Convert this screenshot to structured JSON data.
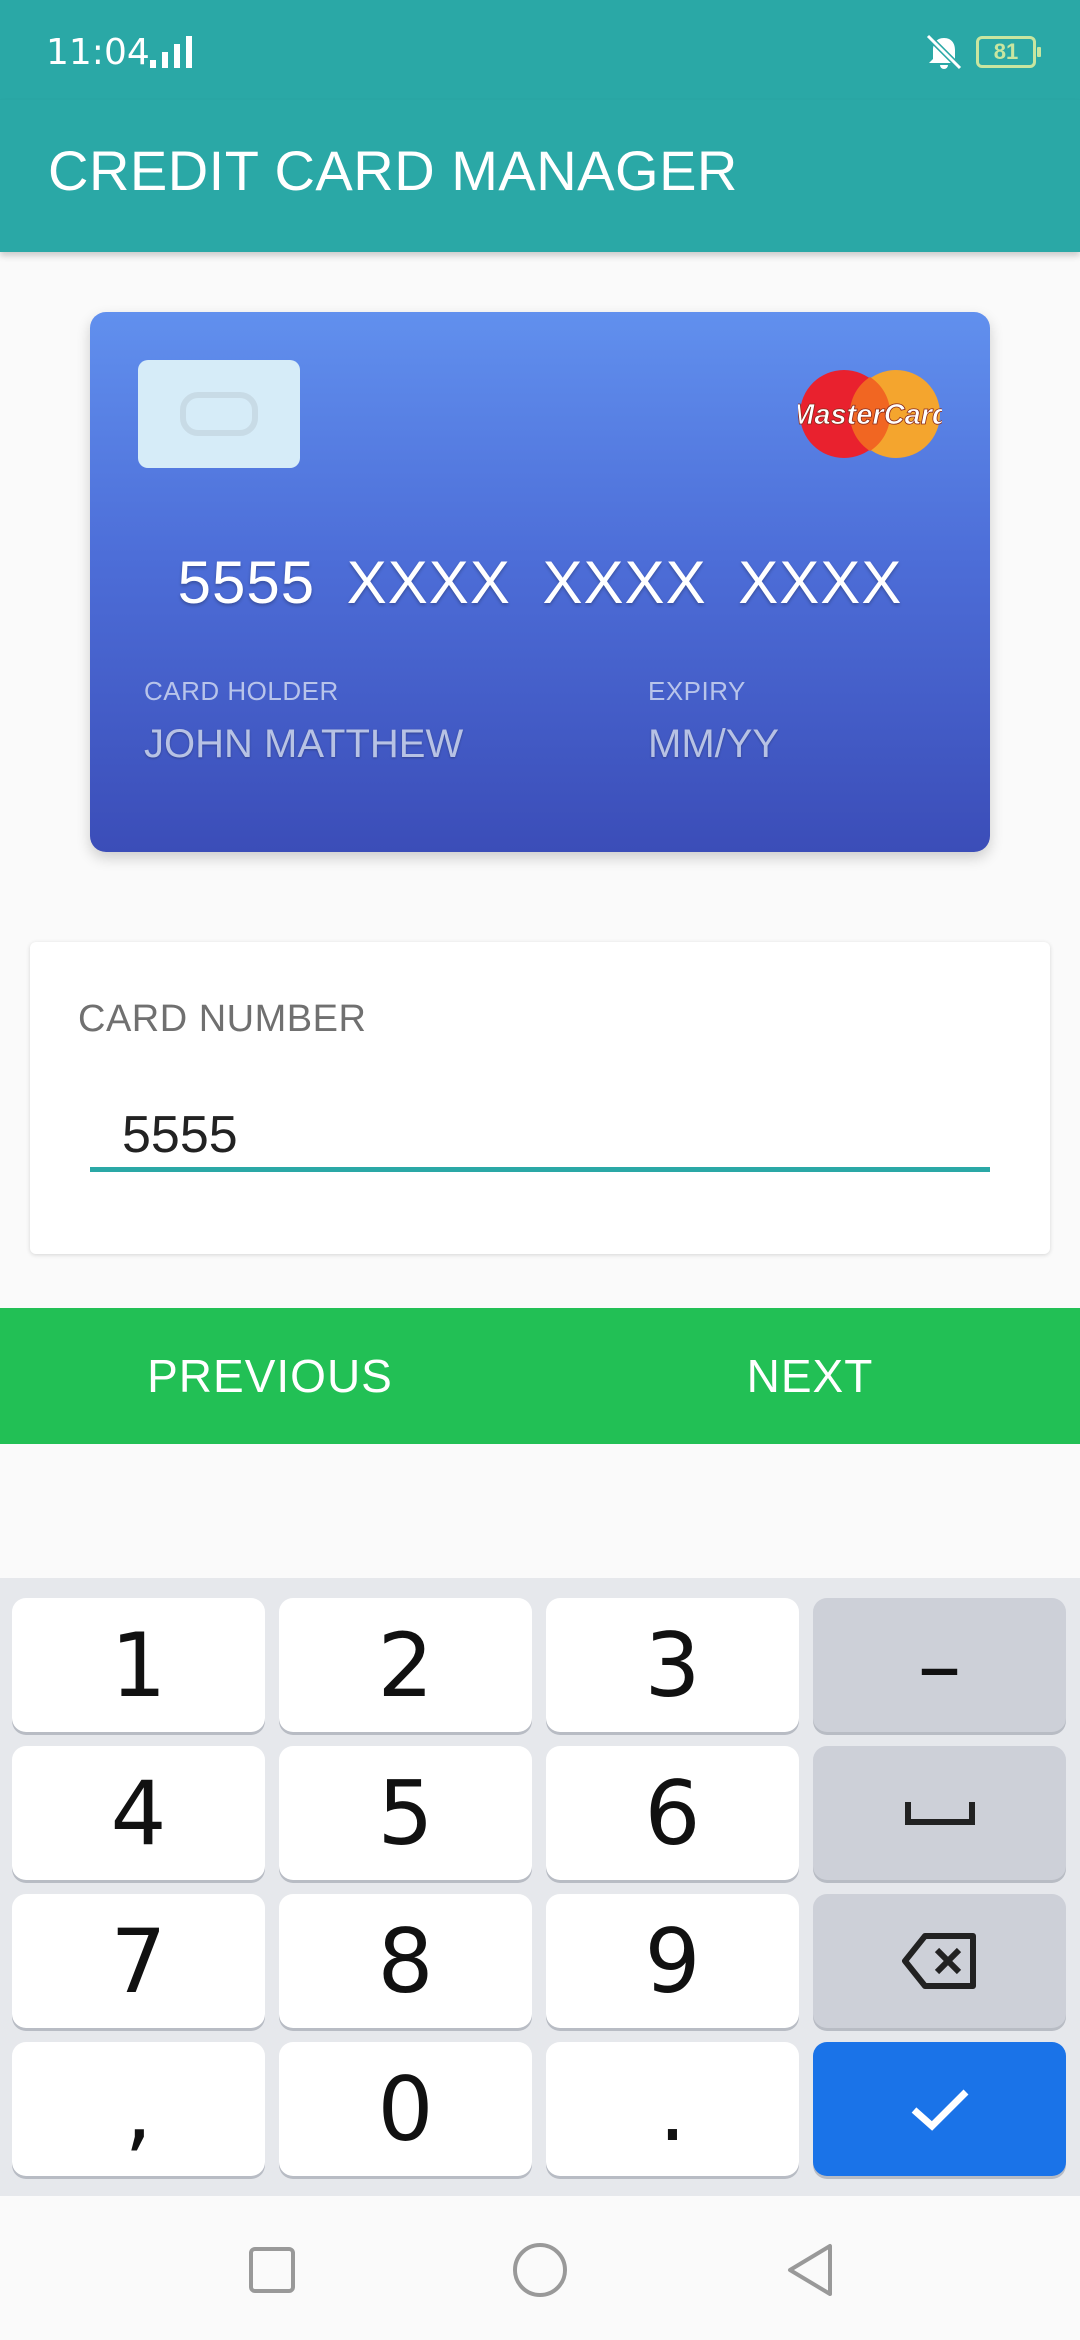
{
  "status_bar": {
    "time": "11:04",
    "battery": "81",
    "icons": [
      "signal-icon",
      "vibrate-muted-icon",
      "battery-icon"
    ]
  },
  "app_bar": {
    "title": "CREDIT CARD MANAGER"
  },
  "card_preview": {
    "number": "5555  XXXX  XXXX  XXXX",
    "holder_label": "CARD HOLDER",
    "holder_value": "JOHN MATTHEW",
    "expiry_label": "EXPIRY",
    "expiry_value": "MM/YY",
    "brand": "MasterCard"
  },
  "form": {
    "label": "CARD NUMBER",
    "value": "5555"
  },
  "nav_buttons": {
    "previous": "PREVIOUS",
    "next": "NEXT"
  },
  "keyboard": {
    "keys": [
      "1",
      "2",
      "3",
      "–",
      "4",
      "5",
      "6",
      "space",
      "7",
      "8",
      "9",
      "backspace",
      ",",
      "0",
      ".",
      "done"
    ]
  },
  "colors": {
    "primary": "#2aa8a6",
    "nav_green": "#22c055",
    "card_top": "#6190ee",
    "card_bottom": "#3b4db8",
    "done_key": "#1a73e8"
  }
}
